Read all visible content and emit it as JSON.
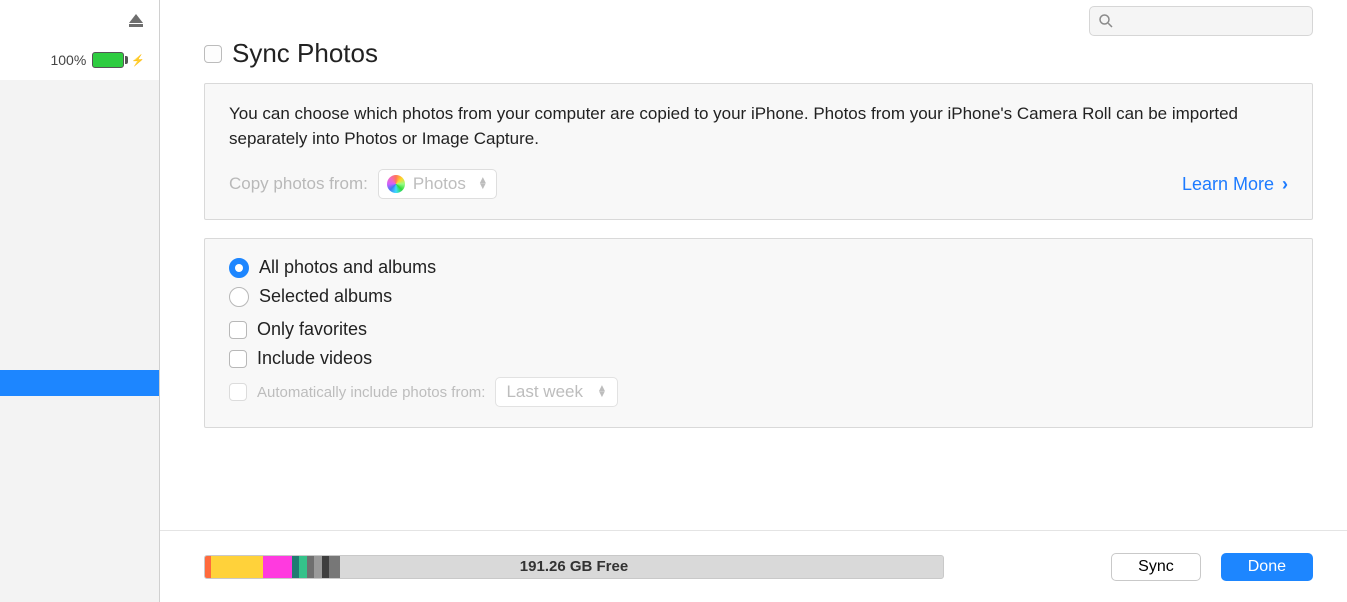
{
  "sidebar": {
    "battery_percent": "100%"
  },
  "search": {
    "placeholder": ""
  },
  "title": "Sync Photos",
  "panel1": {
    "desc": "You can choose which photos from your computer are copied to your iPhone. Photos from your iPhone's Camera Roll can be imported separately into Photos or Image Capture.",
    "copy_label": "Copy photos from:",
    "source_value": "Photos",
    "learn_more": "Learn More"
  },
  "panel2": {
    "radio_all": "All photos and albums",
    "radio_selected": "Selected albums",
    "check_favorites": "Only favorites",
    "check_videos": "Include videos",
    "auto_label": "Automatically include photos from:",
    "auto_value": "Last week"
  },
  "footer": {
    "free_label": "191.26 GB Free",
    "sync_label": "Sync",
    "done_label": "Done",
    "segments": [
      {
        "color": "#ff6a3c",
        "w": "0.8%"
      },
      {
        "color": "#ffd23a",
        "w": "7%"
      },
      {
        "color": "#ff3adf",
        "w": "4%"
      },
      {
        "color": "#207b72",
        "w": "1%"
      },
      {
        "color": "#35c28a",
        "w": "1%"
      },
      {
        "color": "#6f6f6f",
        "w": "1%"
      },
      {
        "color": "#9a9a9a",
        "w": "1%"
      },
      {
        "color": "#3e3e3e",
        "w": "1%"
      },
      {
        "color": "#777777",
        "w": "1.5%"
      }
    ]
  }
}
